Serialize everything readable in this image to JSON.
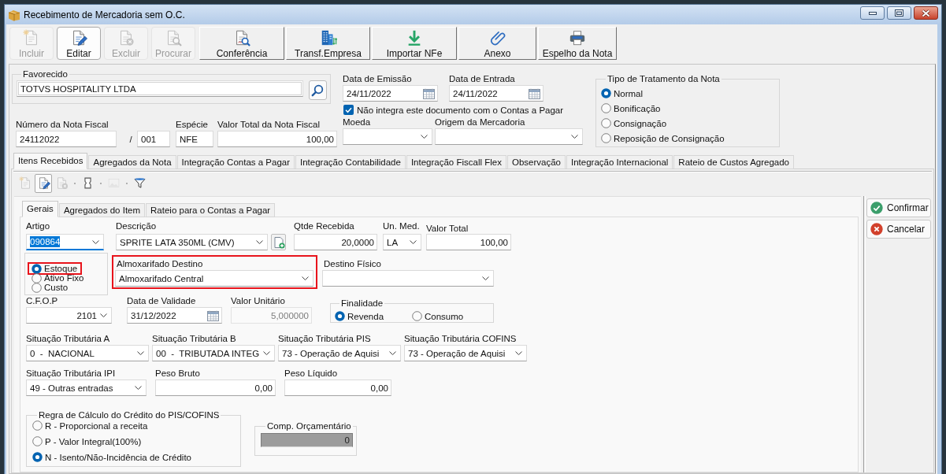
{
  "window": {
    "title": "Recebimento de Mercadoria sem O.C."
  },
  "toolbar": {
    "record_buttons": [
      {
        "label": "Incluir",
        "kind": "new",
        "disabled": true,
        "selected": false
      },
      {
        "label": "Editar",
        "kind": "edit",
        "disabled": false,
        "selected": true
      },
      {
        "label": "Excluir",
        "kind": "delete",
        "disabled": true,
        "selected": false
      },
      {
        "label": "Procurar",
        "kind": "find",
        "disabled": true,
        "selected": false
      }
    ],
    "action_buttons": [
      {
        "label": "Conferência",
        "kind": "review"
      },
      {
        "label": "Transf.Empresa",
        "kind": "transfer"
      },
      {
        "label": "Importar NFe",
        "kind": "import"
      },
      {
        "label": "Anexo",
        "kind": "attach"
      },
      {
        "label": "Espelho da Nota",
        "kind": "print"
      }
    ]
  },
  "header": {
    "favorecido": {
      "title": "Favorecido",
      "value": "TOTVS HOSPITALITY LTDA"
    },
    "data_emissao": {
      "label": "Data de Emissão",
      "value": "24/11/2022"
    },
    "data_entrada": {
      "label": "Data de Entrada",
      "value": "24/11/2022"
    },
    "nao_integra": {
      "label": "Não integra este documento com o Contas a Pagar",
      "checked": true
    },
    "numero_nota": {
      "label": "Número da Nota Fiscal",
      "value": "24112022"
    },
    "serie_separator": "/",
    "serie": {
      "value": "001"
    },
    "especie": {
      "label": "Espécie",
      "value": "NFE"
    },
    "valor_total": {
      "label": "Valor Total da Nota Fiscal",
      "value": "100,00"
    },
    "moeda": {
      "label": "Moeda"
    },
    "origem": {
      "label": "Origem da Mercadoria"
    },
    "tipo_tratamento": {
      "title": "Tipo de Tratamento da Nota",
      "options": [
        {
          "label": "Normal",
          "selected": true
        },
        {
          "label": "Bonificação",
          "selected": false
        },
        {
          "label": "Consignação",
          "selected": false
        },
        {
          "label": "Reposição de Consignação",
          "selected": false
        }
      ]
    }
  },
  "tabs": [
    {
      "label": "Itens Recebidos",
      "selected": true
    },
    {
      "label": "Agregados da Nota",
      "selected": false
    },
    {
      "label": "Integração Contas a Pagar",
      "selected": false
    },
    {
      "label": "Integração Contabilidade",
      "selected": false
    },
    {
      "label": "Integração Fiscall Flex",
      "selected": false
    },
    {
      "label": "Observação",
      "selected": false
    },
    {
      "label": "Integração Internacional",
      "selected": false
    },
    {
      "label": "Rateio de Custos Agregado",
      "selected": false
    }
  ],
  "item_toolbar": [
    {
      "kind": "new",
      "disabled": true,
      "selected": false
    },
    {
      "kind": "edit",
      "disabled": false,
      "selected": true
    },
    {
      "kind": "delete",
      "disabled": true,
      "selected": false
    },
    {
      "kind": "container",
      "disabled": false,
      "selected": false
    },
    {
      "kind": "image",
      "disabled": true,
      "selected": false
    },
    {
      "kind": "filter",
      "disabled": false,
      "selected": false
    }
  ],
  "sub_tabs": [
    {
      "label": "Gerais",
      "selected": true
    },
    {
      "label": "Agregados do Item",
      "selected": false
    },
    {
      "label": "Rateio para o Contas a Pagar",
      "selected": false
    }
  ],
  "item": {
    "artigo": {
      "label": "Artigo",
      "value": "090864",
      "text_selected": true
    },
    "descricao": {
      "label": "Descrição",
      "value": "SPRITE LATA 350ML (CMV)"
    },
    "qtde_recebida": {
      "label": "Qtde Recebida",
      "value": "20,0000"
    },
    "un_med": {
      "label": "Un. Med.",
      "value": "LA"
    },
    "valor_total": {
      "label": "Valor Total",
      "value": "100,00"
    },
    "tipo_artigo": {
      "options": [
        {
          "label": "Estoque",
          "selected": true,
          "highlighted": true
        },
        {
          "label": "Ativo Fixo",
          "selected": false,
          "highlighted": false
        },
        {
          "label": "Custo",
          "selected": false,
          "highlighted": false
        }
      ]
    },
    "almoxarifado_destino": {
      "label": "Almoxarifado Destino",
      "value": "Almoxarifado Central",
      "highlighted": true
    },
    "destino_fisico": {
      "label": "Destino Físico"
    },
    "cfop": {
      "label": "C.F.O.P",
      "value": "2101"
    },
    "data_validade": {
      "label": "Data de Validade",
      "value": "31/12/2022"
    },
    "valor_unitario": {
      "label": "Valor Unitário",
      "value": "5,000000",
      "disabled": true
    },
    "finalidade": {
      "title": "Finalidade",
      "options": [
        {
          "label": "Revenda",
          "selected": true
        },
        {
          "label": "Consumo",
          "selected": false
        }
      ]
    },
    "situacoes": [
      {
        "label": "Situação Tributária A",
        "value": "0  -  NACIONAL"
      },
      {
        "label": "Situação Tributária B",
        "value": "00  -  TRIBUTADA INTEG"
      },
      {
        "label": "Situação Tributária PIS",
        "value": "73 - Operação de Aquisi"
      },
      {
        "label": "Situação Tributária COFINS",
        "value": "73 - Operação de Aquisi"
      }
    ],
    "sit_ipi": {
      "label": "Situação Tributária IPI",
      "value": "49 - Outras entradas"
    },
    "peso_bruto": {
      "label": "Peso Bruto",
      "value": "0,00"
    },
    "peso_liquido": {
      "label": "Peso Líquido",
      "value": "0,00"
    },
    "regra_credito": {
      "title": "Regra de Cálculo do Crédito do PIS/COFINS",
      "options": [
        {
          "label": "R - Proporcional a receita",
          "selected": false
        },
        {
          "label": "P - Valor Integral(100%)",
          "selected": false
        },
        {
          "label": "N - Isento/Não-Incidência de Crédito",
          "selected": true
        }
      ]
    },
    "comp_orcamentario": {
      "title": "Comp. Orçamentário",
      "value": "0",
      "disabled": true
    }
  },
  "side_buttons": [
    {
      "label": "Confirmar",
      "kind": "confirm"
    },
    {
      "label": "Cancelar",
      "kind": "cancel"
    }
  ]
}
